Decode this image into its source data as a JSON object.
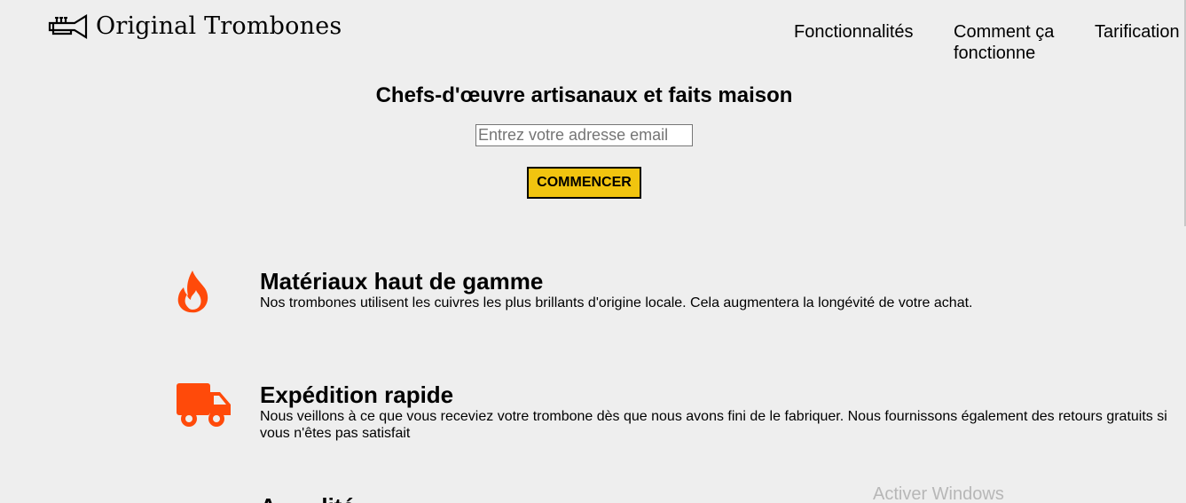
{
  "header": {
    "logo_text": "Original Trombones",
    "logo_icon": "trumpet-icon",
    "nav": [
      {
        "label": "Fonctionnalités"
      },
      {
        "label": "Comment ça fonctionne"
      },
      {
        "label": "Tarification"
      }
    ]
  },
  "hero": {
    "title": "Chefs-d'œuvre artisanaux et faits maison",
    "email_placeholder": "Entrez votre adresse email",
    "email_value": "",
    "button_label": "COMMENCER"
  },
  "features": [
    {
      "icon": "fire-icon",
      "title": "Matériaux haut de gamme",
      "text": "Nos trombones utilisent les cuivres les plus brillants d'origine locale. Cela augmentera la longévité de votre achat."
    },
    {
      "icon": "truck-icon",
      "title": "Expédition rapide",
      "text": "Nous veillons à ce que vous receviez votre trombone dès que nous avons fini de le fabriquer. Nous fournissons également des retours gratuits si vous n'êtes pas satisfait"
    },
    {
      "title": "A...   ...lité"
    }
  ],
  "overlay": {
    "watermark": "Activer Windows"
  },
  "colors": {
    "background": "#eeeeee",
    "button": "#f1c40f",
    "icon_accent": "#ff4a0a"
  }
}
